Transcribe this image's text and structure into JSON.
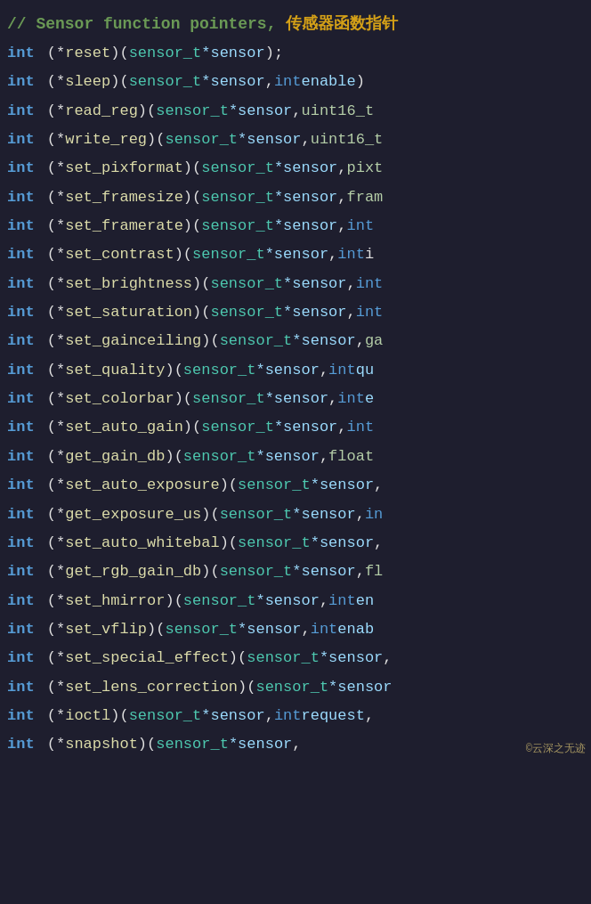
{
  "comment": {
    "text": "// Sensor function pointers,",
    "chinese": " 传感器函数指针"
  },
  "lines": [
    {
      "keyword": "int",
      "content": "(*reset)(sensor_t *sensor);"
    },
    {
      "keyword": "int",
      "content": "(*sleep)(sensor_t *sensor, int enable)"
    },
    {
      "keyword": "int",
      "content": "(*read_reg)(sensor_t *sensor, uint16_t"
    },
    {
      "keyword": "int",
      "content": "(*write_reg)(sensor_t *sensor, uint16_t"
    },
    {
      "keyword": "int",
      "content": "(*set_pixformat)(sensor_t *sensor, pixt"
    },
    {
      "keyword": "int",
      "content": "(*set_framesize)(sensor_t *sensor, fram"
    },
    {
      "keyword": "int",
      "content": "(*set_framerate)(sensor_t *sensor, int"
    },
    {
      "keyword": "int",
      "content": "(*set_contrast)(sensor_t *sensor, int i"
    },
    {
      "keyword": "int",
      "content": "(*set_brightness)(sensor_t *sensor, int"
    },
    {
      "keyword": "int",
      "content": "(*set_saturation)(sensor_t *sensor, int"
    },
    {
      "keyword": "int",
      "content": "(*set_gainceiling)(sensor_t *sensor, ga"
    },
    {
      "keyword": "int",
      "content": "(*set_quality)(sensor_t *sensor, int qu"
    },
    {
      "keyword": "int",
      "content": "(*set_colorbar)(sensor_t *sensor, int e"
    },
    {
      "keyword": "int",
      "content": "(*set_auto_gain)(sensor_t *sensor, int"
    },
    {
      "keyword": "int",
      "content": "(*get_gain_db)(sensor_t *sensor, float"
    },
    {
      "keyword": "int",
      "content": "(*set_auto_exposure)(sensor_t *sensor,"
    },
    {
      "keyword": "int",
      "content": "(*get_exposure_us)(sensor_t *sensor, in"
    },
    {
      "keyword": "int",
      "content": "(*set_auto_whitebal)(sensor_t *sensor,"
    },
    {
      "keyword": "int",
      "content": "(*get_rgb_gain_db)(sensor_t *sensor, fl"
    },
    {
      "keyword": "int",
      "content": "(*set_hmirror)(sensor_t *sensor, int en"
    },
    {
      "keyword": "int",
      "content": "(*set_vflip)(sensor_t *sensor, int enab"
    },
    {
      "keyword": "int",
      "content": "(*set_special_effect)(sensor_t *sensor,"
    },
    {
      "keyword": "int",
      "content": "(*set_lens_correction)(sensor_t *sensor"
    },
    {
      "keyword": "int",
      "content": "(*ioctl)(sensor_t *sensor, int request,"
    },
    {
      "keyword": "int",
      "content": "(*snapshot)(sensor_t *sensor,"
    }
  ],
  "watermark": "©云深之无迹"
}
